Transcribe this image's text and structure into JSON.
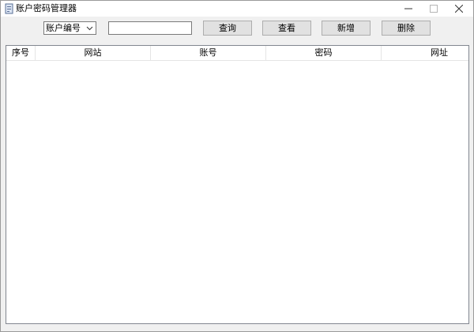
{
  "window": {
    "title": "账户密码管理器"
  },
  "icons": {
    "app": "app-icon",
    "minimize": "minimize-icon",
    "maximize": "maximize-icon",
    "close": "close-icon",
    "dropdown": "chevron-down-icon"
  },
  "toolbar": {
    "select_value": "账户编号",
    "search_value": "",
    "query_label": "查询",
    "view_label": "查看",
    "add_label": "新增",
    "delete_label": "删除"
  },
  "table": {
    "columns": [
      "序号",
      "网站",
      "账号",
      "密码",
      "网址"
    ],
    "rows": []
  },
  "colors": {
    "window_bg": "#f0f0f0",
    "button_bg": "#e1e1e1",
    "button_border": "#adadad"
  }
}
